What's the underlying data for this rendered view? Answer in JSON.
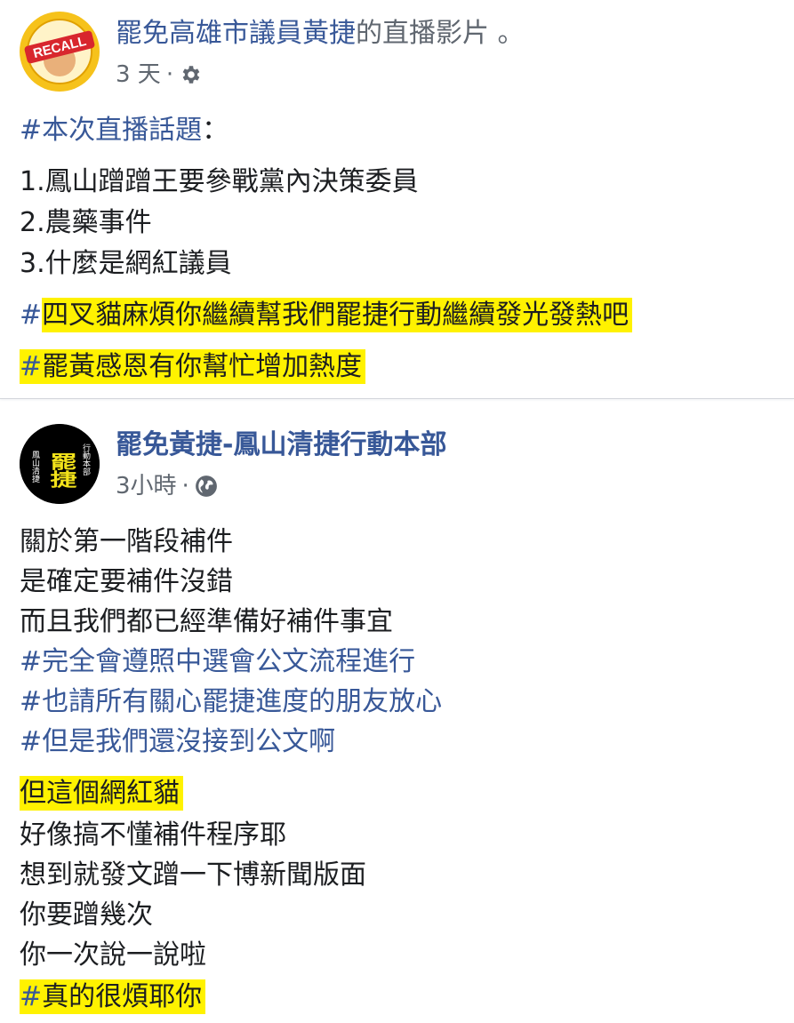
{
  "post1": {
    "author": "罷免高雄市議員黃捷",
    "author_suffix": "的直播影片 。",
    "time": "3 天",
    "dot": "·",
    "avatar_text": "RECALL",
    "topic_hash": "#",
    "topic_text": "本次直播話題",
    "topic_colon": "：",
    "items": [
      "1.鳳山蹭蹭王要參戰黨內決策委員",
      "2.農藥事件",
      "3.什麼是網紅議員"
    ],
    "tag1_hash": "#",
    "tag1_text": "四叉貓麻煩你繼續幫我們罷捷行動繼續發光發熱吧",
    "tag2_hash": "#",
    "tag2_text": "罷黃感恩有你幫忙增加熱度"
  },
  "post2": {
    "author": "罷免黃捷-鳳山清捷行動本部",
    "time": "3小時",
    "dot": "·",
    "avatar_big": "罷捷",
    "avatar_left": "鳳山清捷",
    "avatar_right": "行動本部",
    "lines1": [
      "關於第一階段補件",
      "是確定要補件沒錯",
      "而且我們都已經準備好補件事宜"
    ],
    "tags": [
      {
        "hash": "#",
        "text": "完全會遵照中選會公文流程進行"
      },
      {
        "hash": "#",
        "text": "也請所有關心罷捷進度的朋友放心"
      },
      {
        "hash": "#",
        "text": "但是我們還沒接到公文啊"
      }
    ],
    "highlight_line": "但這個網紅貓",
    "lines2": [
      "好像搞不懂補件程序耶",
      "想到就發文蹭一下博新聞版面",
      "你要蹭幾次",
      "你一次說一說啦"
    ],
    "final_hash": "#",
    "final_text": "真的很煩耶你"
  },
  "colors": {
    "link": "#385898",
    "meta": "#606770",
    "highlight": "#fff200",
    "divider": "#d3d6db"
  },
  "icons": {
    "post1_privacy": "gear-icon",
    "post2_privacy": "globe-icon"
  }
}
